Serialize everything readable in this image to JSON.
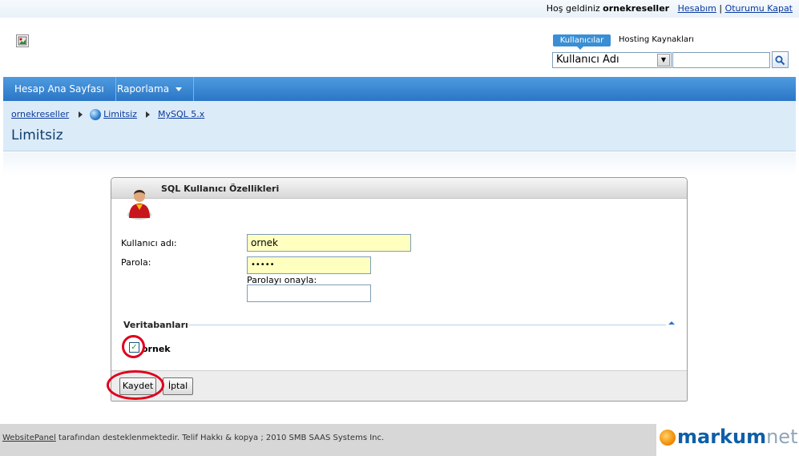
{
  "topbar": {
    "welcome_prefix": "Hoş geldiniz",
    "username": "ornekreseller",
    "account_link": "Hesabım",
    "separator": "|",
    "logout_link": "Oturumu Kapat"
  },
  "search": {
    "tab_active": "Kullanıcılar",
    "tab_other": "Hosting Kaynakları",
    "select_value": "Kullanıcı Adı",
    "input_value": "",
    "search_icon": "magnifier-icon"
  },
  "nav": {
    "items": [
      {
        "label": "Hesap Ana Sayfası"
      },
      {
        "label": "Raporlama"
      }
    ]
  },
  "breadcrumb": {
    "items": [
      "ornekreseller",
      "Limitsiz",
      "MySQL 5.x"
    ]
  },
  "page": {
    "title": "Limitsiz"
  },
  "panel": {
    "title": "SQL Kullanıcı Özellikleri",
    "username_label": "Kullanıcı adı:",
    "username_value": "ornek",
    "password_label": "Parola:",
    "password_value": "•••••",
    "confirm_label": "Parolayı onayla:",
    "confirm_value": "",
    "databases_title": "Veritabanları",
    "database_item": "ornek",
    "database_checked": true,
    "save_button": "Kaydet",
    "cancel_button": "İptal"
  },
  "footer": {
    "link": "WebsitePanel",
    "text": " tarafından desteklenmektedir. Telif Hakkı & kopya ; 2010 SMB SAAS Systems Inc."
  },
  "brand": {
    "part1": "markum",
    "part2": "net"
  },
  "colors": {
    "accent": "#2a76c6",
    "highlight": "#e0001b",
    "field_yellow": "#ffffc0"
  }
}
